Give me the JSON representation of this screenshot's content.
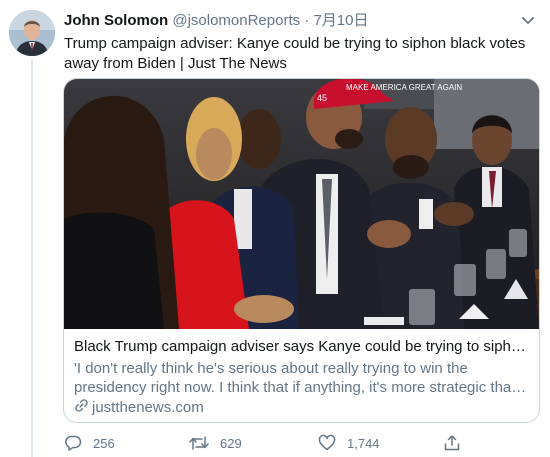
{
  "tweet": {
    "author_name": "John Solomon",
    "handle": "@jsolomonReports",
    "separator": "·",
    "date": "7月10日",
    "text": "Trump campaign adviser: Kanye could be trying to siphon black votes away from Biden | Just The News"
  },
  "card": {
    "title": "Black Trump campaign adviser says Kanye could be trying to siphon black votes away from Biden",
    "description": "'I don't really think he's serious about really trying to win the presidency right now. I think that if anything, it's more strategic than anything.'",
    "domain": "justthenews.com",
    "hat_text": "MAKE AMERICA GREAT AGAIN",
    "hat_number": "45"
  },
  "actions": {
    "replies": "256",
    "retweets": "629",
    "likes": "1,744"
  },
  "icons": {
    "reply": "speech-bubble-icon",
    "retweet": "retweet-icon",
    "like": "heart-icon",
    "share": "share-icon",
    "link": "link-icon",
    "more": "chevron-down-icon"
  },
  "colors": {
    "text": "#14171a",
    "secondary": "#657786",
    "border": "#ccd6dd"
  }
}
